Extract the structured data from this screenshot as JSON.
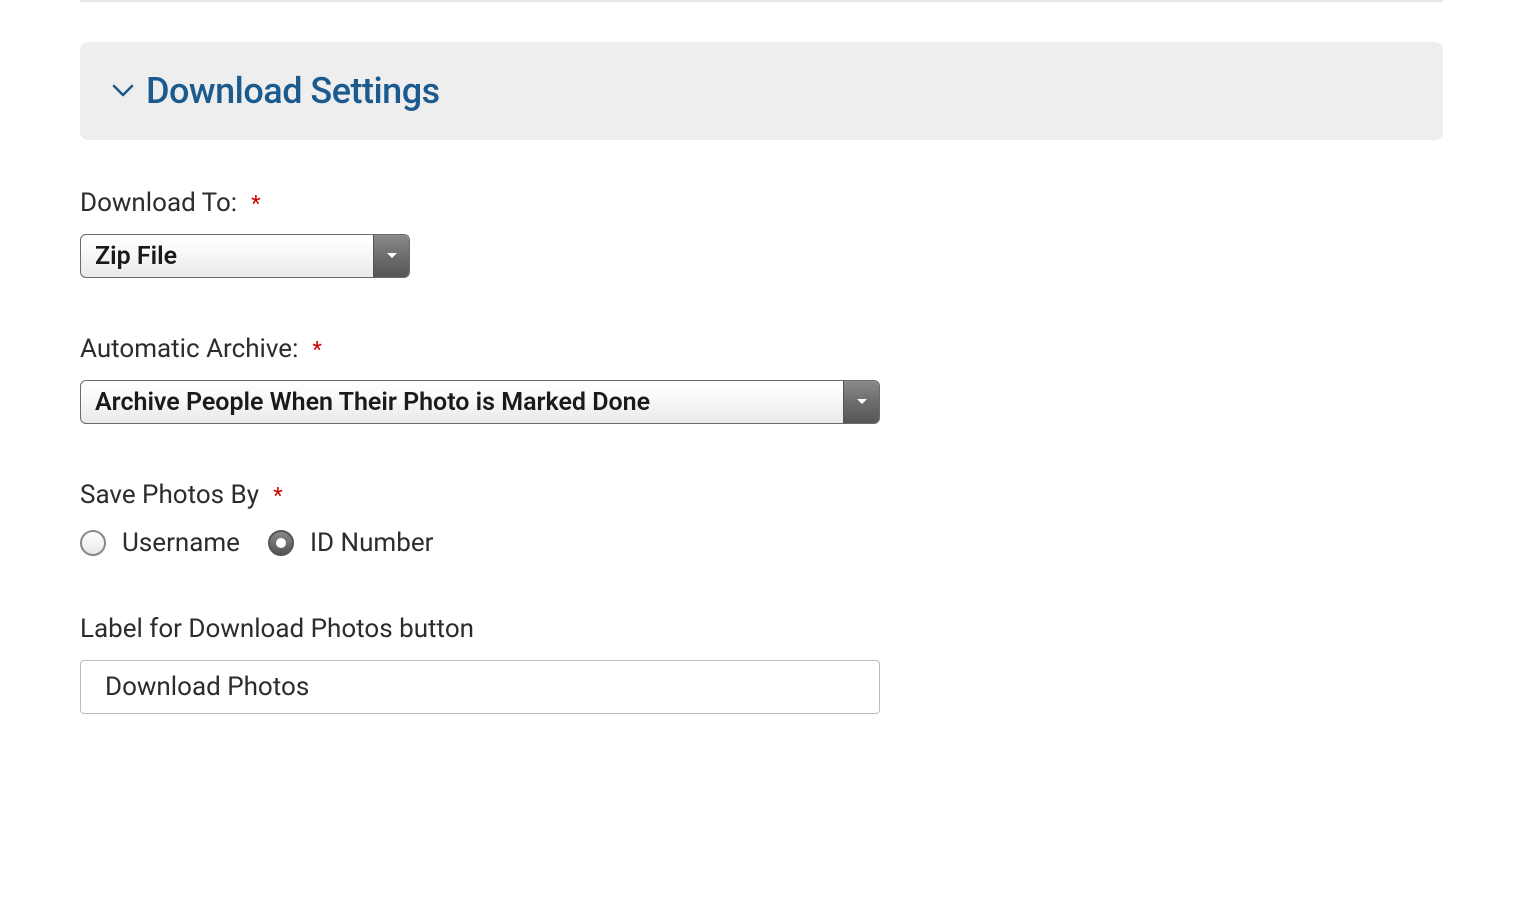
{
  "section": {
    "title": "Download Settings"
  },
  "form": {
    "downloadTo": {
      "label": "Download To:",
      "value": "Zip File"
    },
    "automaticArchive": {
      "label": "Automatic Archive:",
      "value": "Archive People When Their Photo is Marked Done"
    },
    "savePhotosBy": {
      "label": "Save Photos By",
      "options": {
        "username": "Username",
        "idNumber": "ID Number"
      }
    },
    "labelForDownload": {
      "label": "Label for Download Photos button",
      "value": "Download Photos"
    }
  }
}
